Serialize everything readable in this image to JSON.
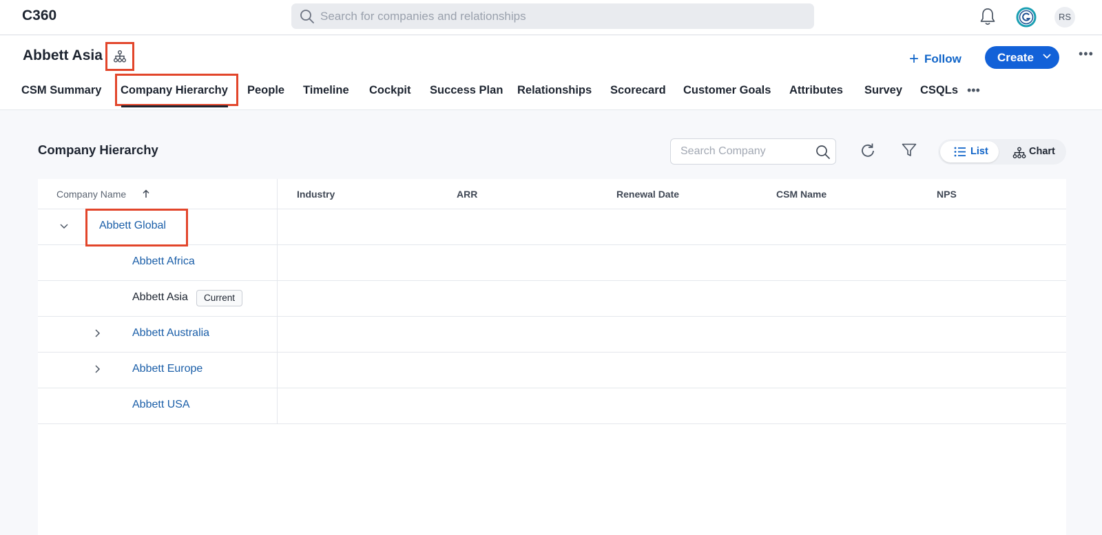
{
  "app": {
    "title": "C360"
  },
  "global_search": {
    "placeholder": "Search for companies and relationships"
  },
  "user": {
    "initials": "RS"
  },
  "header": {
    "company_name": "Abbett Asia",
    "follow_label": "Follow",
    "create_label": "Create"
  },
  "tabs": [
    {
      "label": "CSM Summary"
    },
    {
      "label": "Company Hierarchy",
      "active": true
    },
    {
      "label": "People"
    },
    {
      "label": "Timeline"
    },
    {
      "label": "Cockpit"
    },
    {
      "label": "Success Plan"
    },
    {
      "label": "Relationships"
    },
    {
      "label": "Scorecard"
    },
    {
      "label": "Customer Goals"
    },
    {
      "label": "Attributes"
    },
    {
      "label": "Survey"
    },
    {
      "label": "CSQLs"
    }
  ],
  "panel": {
    "title": "Company Hierarchy",
    "search_placeholder": "Search Company",
    "view_list_label": "List",
    "view_chart_label": "Chart",
    "selected_view": "List"
  },
  "table": {
    "columns": [
      "Company Name",
      "Industry",
      "ARR",
      "Renewal Date",
      "CSM Name",
      "NPS"
    ],
    "sort_column": "Company Name",
    "sort_direction": "ascending",
    "rows": [
      {
        "name": "Abbett Global",
        "expanded": true,
        "link": true
      },
      {
        "name": "Abbett Africa",
        "link": true
      },
      {
        "name": "Abbett Asia",
        "link": false,
        "badge": "Current"
      },
      {
        "name": "Abbett Australia",
        "expanded": false,
        "link": true
      },
      {
        "name": "Abbett Europe",
        "expanded": false,
        "link": true
      },
      {
        "name": "Abbett USA",
        "link": true
      }
    ]
  },
  "colors": {
    "accent": "#1261d8",
    "link": "#1a5ea8",
    "highlight": "#e2452a"
  }
}
